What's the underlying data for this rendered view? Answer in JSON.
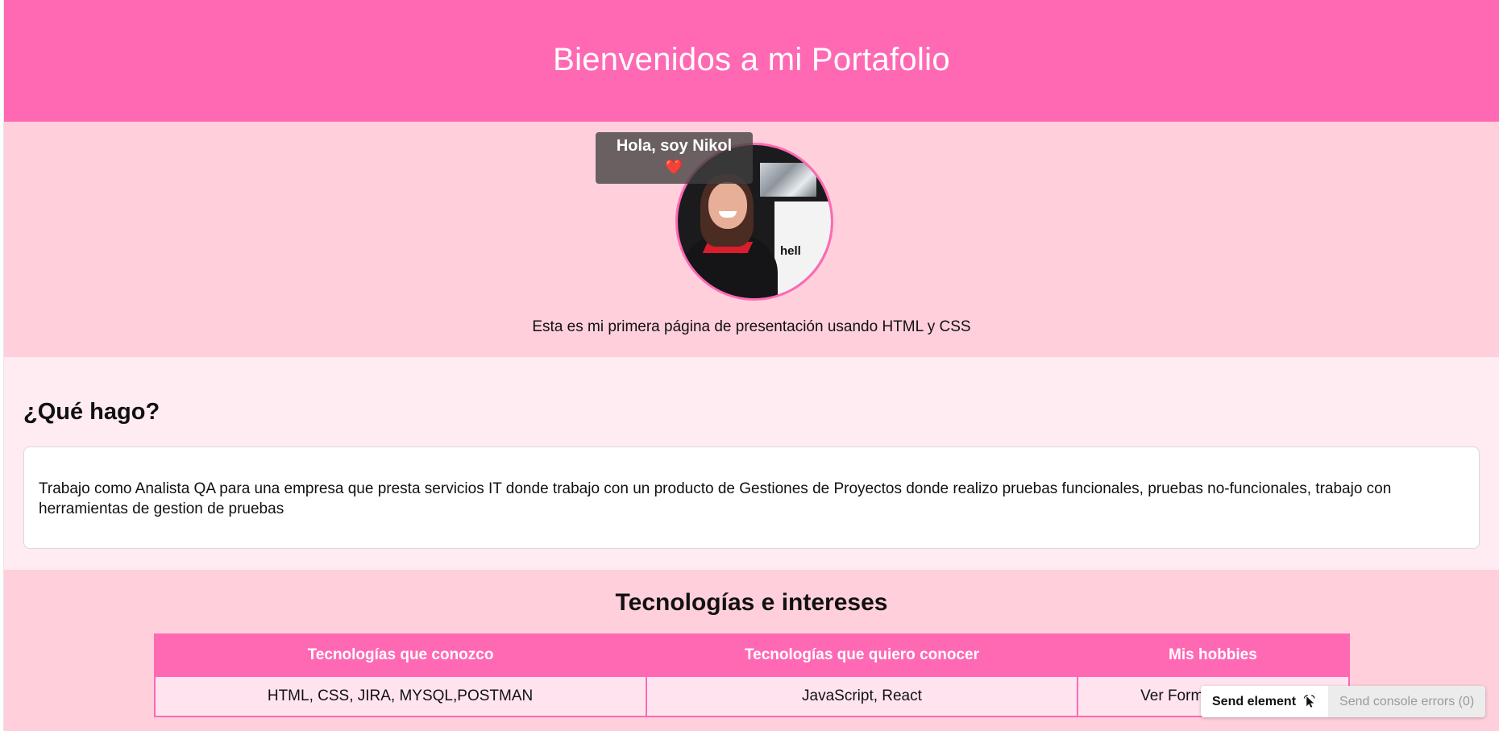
{
  "header": {
    "title": "Bienvenidos a mi Portafolio"
  },
  "hero": {
    "tag_text": "Hola, soy Nikol",
    "tag_emoji": "❤️",
    "photo_text": "hell",
    "subtitle": "Esta es mi primera página de presentación usando HTML y CSS"
  },
  "about": {
    "heading": "¿Qué hago?",
    "body": "Trabajo como Analista QA para una empresa que presta servicios IT donde trabajo con un producto de Gestiones de Proyectos donde realizo pruebas funcionales, pruebas no-funcionales, trabajo con herramientas de gestion de pruebas"
  },
  "tech": {
    "heading": "Tecnologías e intereses",
    "columns": [
      "Tecnologías que conozco",
      "Tecnologías que quiero conocer",
      "Mis hobbies"
    ],
    "rows": [
      [
        "HTML, CSS, JIRA, MYSQL,POSTMAN",
        "JavaScript, React",
        "Ver Formula1, Pelicul"
      ]
    ]
  },
  "extension": {
    "send_element_label": "Send element",
    "send_errors_label": "Send console errors (0)"
  },
  "colors": {
    "primary_pink": "#ff69b4",
    "light_pink": "#ffcfdc",
    "pale_pink": "#ffebf2"
  }
}
